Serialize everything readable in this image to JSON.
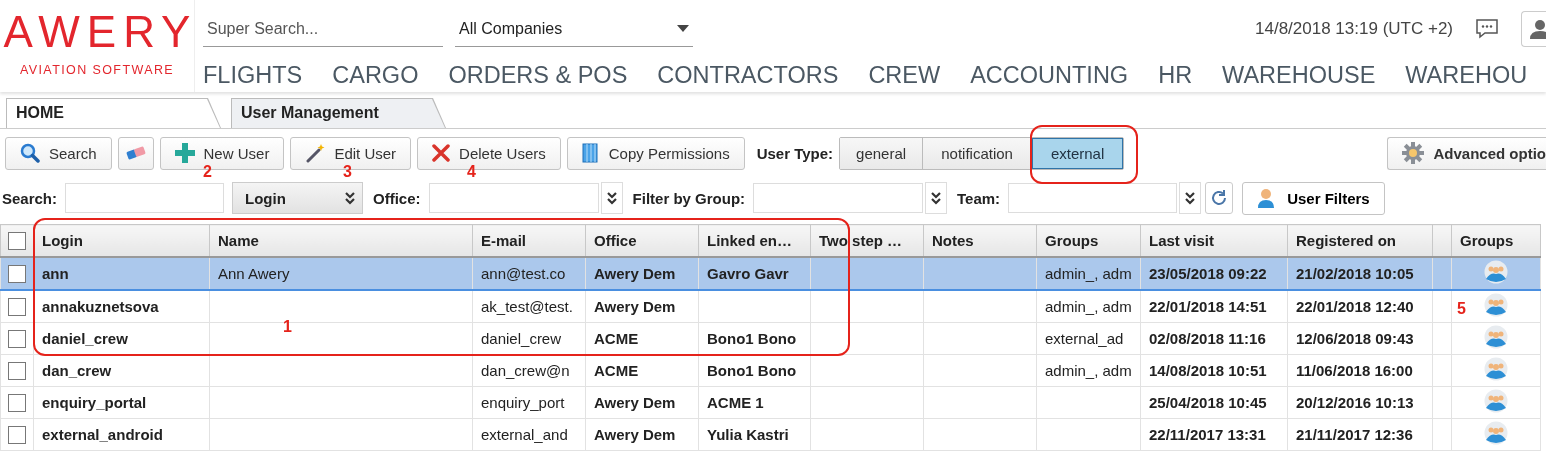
{
  "header": {
    "logo": {
      "name": "AWERY",
      "tagline": "AVIATION SOFTWARE"
    },
    "super_search": {
      "placeholder": "Super Search..."
    },
    "company_select": {
      "value": "All Companies"
    },
    "datetime": "14/8/2018 13:19 (UTC +2)",
    "nav": [
      "FLIGHTS",
      "CARGO",
      "ORDERS & POS",
      "CONTRACTORS",
      "CREW",
      "ACCOUNTING",
      "HR",
      "WAREHOUSE",
      "WAREHOU"
    ]
  },
  "tabs": [
    {
      "label": "HOME",
      "selected": false
    },
    {
      "label": "User Management",
      "selected": true
    }
  ],
  "toolbar": {
    "buttons": [
      {
        "kind": "search",
        "label": "Search"
      },
      {
        "kind": "eraser"
      },
      {
        "kind": "plus",
        "label": "New User"
      },
      {
        "kind": "wand",
        "label": "Edit User"
      },
      {
        "kind": "cross",
        "label": "Delete Users"
      },
      {
        "kind": "copy",
        "label": "Copy Permissions"
      }
    ],
    "user_type": {
      "label": "User Type:",
      "options": [
        {
          "label": "general",
          "selected": false
        },
        {
          "label": "notification",
          "selected": false
        },
        {
          "label": "external",
          "selected": true
        }
      ]
    },
    "advanced_options": "Advanced optio"
  },
  "filters": {
    "search_label": "Search:",
    "search_by": "Login",
    "office_label": "Office:",
    "group_label": "Filter by Group:",
    "team_label": "Team:",
    "user_filters": "User Filters"
  },
  "table": {
    "select_all": {
      "checked": false
    },
    "columns": [
      "Login",
      "Name",
      "E-mail",
      "Office",
      "Linked en…",
      "Two step …",
      "Notes",
      "Groups",
      "Last visit",
      "Registered on",
      "",
      "Groups"
    ],
    "rows": [
      {
        "selected": true,
        "checked": false,
        "login": "ann",
        "name": "Ann Awery",
        "email": "ann@test.co",
        "office": "Awery Dem",
        "linked": "Gavro Gavr",
        "groups": "admin_, adm",
        "last_visit": "23/05/2018 09:22",
        "registered_on": "21/02/2018 10:05"
      },
      {
        "selected": false,
        "checked": false,
        "login": "annakuznetsova",
        "email": "ak_test@test.",
        "office": "Awery Dem",
        "groups": "admin_, adm",
        "last_visit": "22/01/2018 14:51",
        "registered_on": "22/01/2018 12:40"
      },
      {
        "selected": false,
        "checked": false,
        "login": "daniel_crew",
        "email": "daniel_crew",
        "office": "ACME",
        "linked": "Bono1 Bono",
        "groups": "external_ad",
        "last_visit": "02/08/2018 11:16",
        "registered_on": "12/06/2018 09:43"
      },
      {
        "selected": false,
        "checked": false,
        "login": "dan_crew",
        "email": "dan_crew@n",
        "office": "ACME",
        "linked": "Bono1 Bono",
        "groups": "admin_, adm",
        "last_visit": "14/08/2018 10:51",
        "registered_on": "11/06/2018 16:00"
      },
      {
        "selected": false,
        "checked": false,
        "login": "enquiry_portal",
        "email": "enquiry_port",
        "office": "Awery Dem",
        "linked": "ACME 1",
        "last_visit": "25/04/2018 10:45",
        "registered_on": "20/12/2016 10:13"
      },
      {
        "selected": false,
        "checked": false,
        "login": "external_android",
        "email": "external_and",
        "office": "Awery Dem",
        "linked": "Yulia Kastri",
        "last_visit": "22/11/2017 13:31",
        "registered_on": "21/11/2017 12:36"
      }
    ]
  },
  "annotations": [
    {
      "label": "1"
    },
    {
      "label": "2"
    },
    {
      "label": "3"
    },
    {
      "label": "4"
    },
    {
      "label": "5"
    }
  ]
}
